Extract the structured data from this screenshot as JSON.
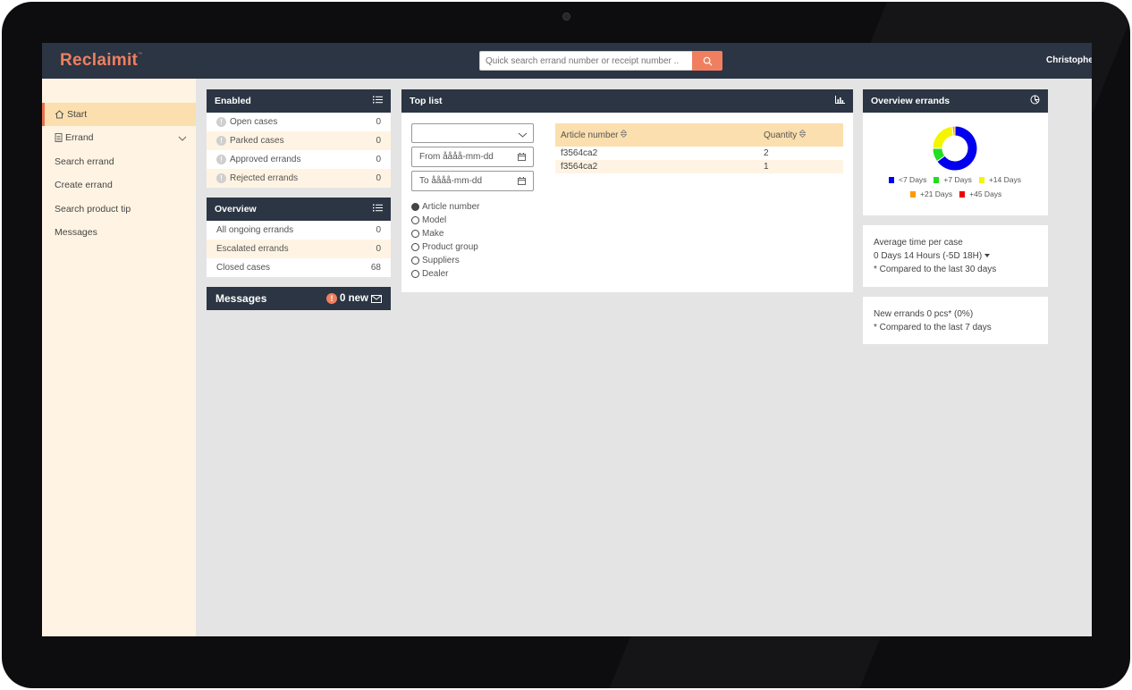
{
  "app": {
    "logo_text": "Reclaimit",
    "logo_tm": "™",
    "search_placeholder": "Quick search errand number or receipt number ..",
    "user_name": "Christopher",
    "brand_color": "#f07f5f",
    "header_color": "#2b3543"
  },
  "sidebar": {
    "items": [
      {
        "label": "Start",
        "icon": "home-icon"
      },
      {
        "label": "Errand",
        "icon": "document-icon"
      },
      {
        "label": "Search errand"
      },
      {
        "label": "Create errand"
      },
      {
        "label": "Search product tip"
      },
      {
        "label": "Messages"
      }
    ]
  },
  "enabled": {
    "title": "Enabled",
    "rows": [
      {
        "label": "Open cases",
        "value": "0"
      },
      {
        "label": "Parked cases",
        "value": "0"
      },
      {
        "label": "Approved errands",
        "value": "0"
      },
      {
        "label": "Rejected errands",
        "value": "0"
      }
    ]
  },
  "overview": {
    "title": "Overview",
    "rows": [
      {
        "label": "All ongoing errands",
        "value": "0"
      },
      {
        "label": "Escalated errands",
        "value": "0"
      },
      {
        "label": "Closed cases",
        "value": "68"
      }
    ]
  },
  "messages": {
    "title": "Messages",
    "new_label": "0 new"
  },
  "toplist": {
    "title": "Top list",
    "dropdown_value": "",
    "from_label": "From",
    "from_value": "åååå-mm-dd",
    "to_label": "To",
    "to_value": "åååå-mm-dd",
    "options": [
      "Article number",
      "Model",
      "Make",
      "Product group",
      "Suppliers",
      "Dealer"
    ],
    "selected_option": "Article number",
    "table": {
      "headers": [
        "Article number",
        "Quantity"
      ],
      "rows": [
        {
          "article": "f3564ca2",
          "qty": "2"
        },
        {
          "article": "f3564ca2",
          "qty": "1"
        }
      ]
    }
  },
  "overview_errands": {
    "title": "Overview errands",
    "legend": [
      {
        "label": "<7 Days",
        "color": "#0000ee"
      },
      {
        "label": "+7 Days",
        "color": "#22dd22"
      },
      {
        "label": "+14 Days",
        "color": "#f5f500"
      },
      {
        "label": "+21 Days",
        "color": "#ff9900"
      },
      {
        "label": "+45 Days",
        "color": "#ee0000"
      }
    ]
  },
  "chart_data": {
    "type": "pie",
    "categories": [
      "<7 Days",
      "+7 Days",
      "+14 Days",
      "+21 Days",
      "+45 Days"
    ],
    "values": [
      65,
      10,
      23,
      2,
      0
    ],
    "colors": [
      "#0000ee",
      "#22dd22",
      "#f5f500",
      "#ff9900",
      "#ee0000"
    ],
    "legend_position": "bottom"
  },
  "avg_time": {
    "title": "Average time per case",
    "value": "0 Days 14 Hours (-5D 18H)",
    "note": "* Compared to the last 30 days"
  },
  "new_errands": {
    "value": "New errands 0 pcs* (0%)",
    "note": "* Compared to the last 7 days"
  }
}
